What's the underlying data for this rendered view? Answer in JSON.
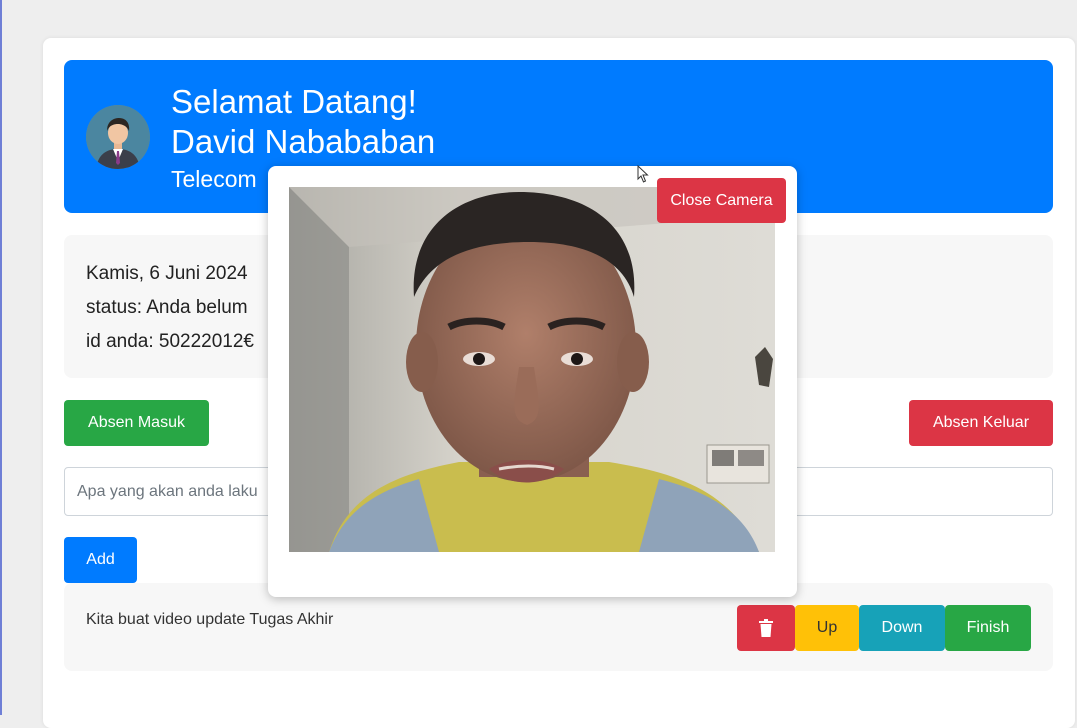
{
  "header": {
    "welcome": "Selamat Datang!",
    "name": "David Nabababan",
    "company": "Telecom"
  },
  "info": {
    "date": "Kamis, 6 Juni 2024",
    "status": "status: Anda belum",
    "id": "id anda: 50222012€"
  },
  "actions": {
    "check_in": "Absen Masuk",
    "check_out": "Absen Keluar"
  },
  "task_input": {
    "placeholder": "Apa yang akan anda laku",
    "add_label": "Add"
  },
  "todos": [
    {
      "text": "Kita buat video update Tugas Akhir",
      "up_label": "Up",
      "down_label": "Down",
      "finish_label": "Finish"
    }
  ],
  "camera_modal": {
    "close_label": "Close Camera"
  },
  "colors": {
    "primary": "#007bff",
    "success": "#28a745",
    "danger": "#dc3545",
    "warning": "#ffc107",
    "info": "#17a2b8"
  }
}
